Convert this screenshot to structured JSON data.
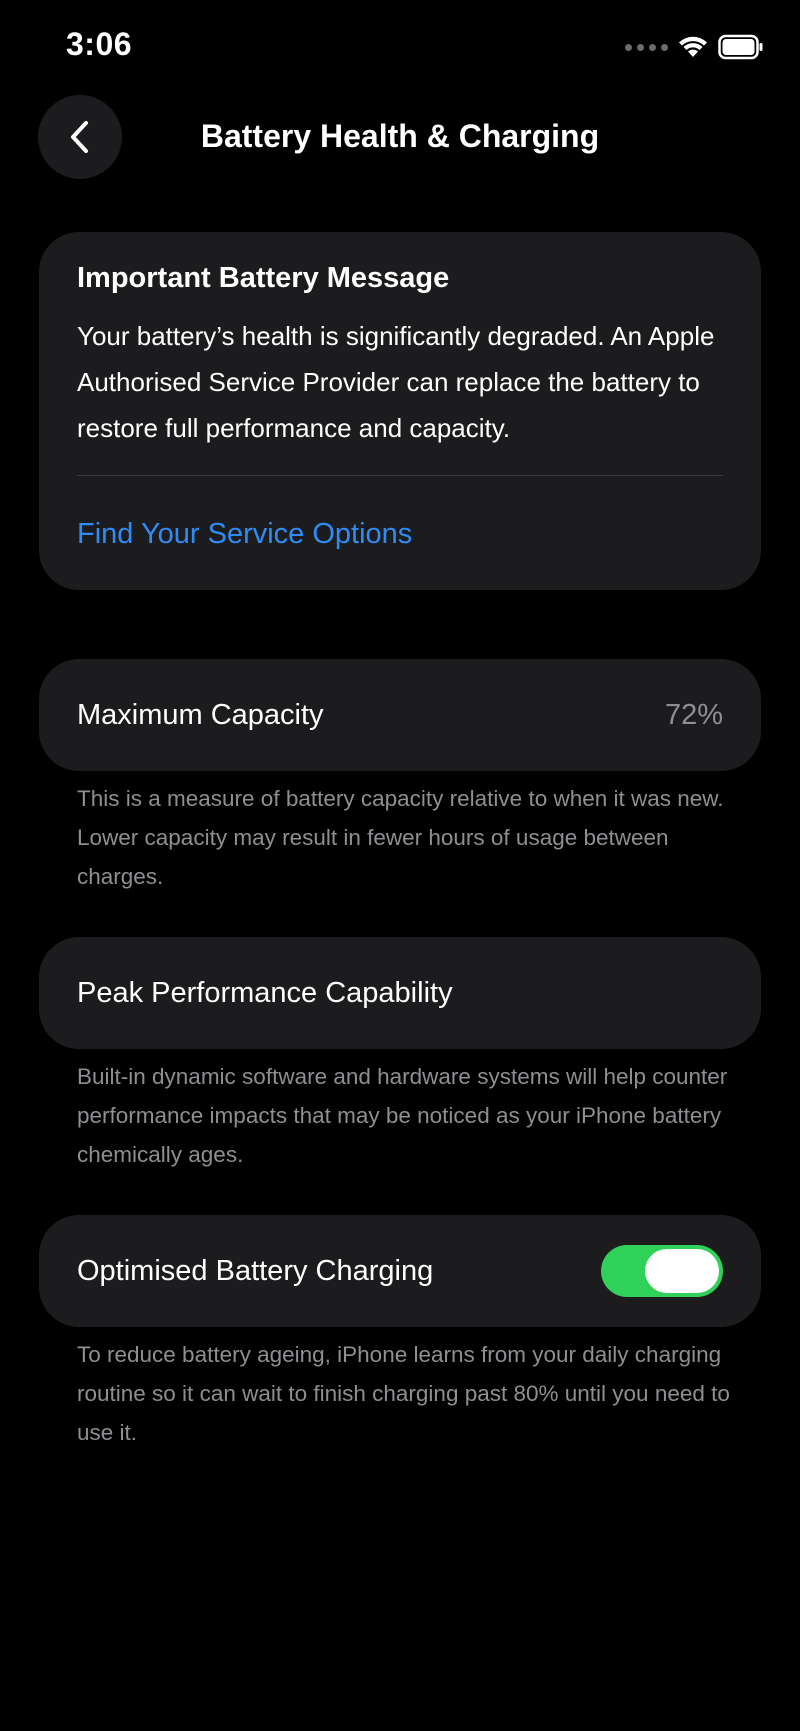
{
  "status_bar": {
    "time": "3:06",
    "icons": [
      "signal-dots-icon",
      "wifi-icon",
      "battery-icon"
    ]
  },
  "nav": {
    "back_icon": "chevron-left-icon",
    "title": "Battery Health & Charging"
  },
  "message_card": {
    "title": "Important Battery Message",
    "body": "Your battery’s health is significantly degraded. An Apple Authorised Service Provider can replace the battery to restore full performance and capacity.",
    "link_label": "Find Your Service Options",
    "link_color": "#2f8cf5"
  },
  "maximum_capacity": {
    "label": "Maximum Capacity",
    "value": "72%",
    "footnote": "This is a measure of battery capacity relative to when it was new. Lower capacity may result in fewer hours of usage between charges."
  },
  "peak_performance": {
    "label": "Peak Performance Capability",
    "footnote": "Built-in dynamic software and hardware systems will help counter performance impacts that may be noticed as your iPhone battery chemically ages."
  },
  "optimised_charging": {
    "label": "Optimised Battery Charging",
    "enabled": true,
    "toggle_color": "#30d158",
    "footnote": "To reduce battery ageing, iPhone learns from your daily charging routine so it can wait to finish charging past 80% until you need to use it."
  }
}
